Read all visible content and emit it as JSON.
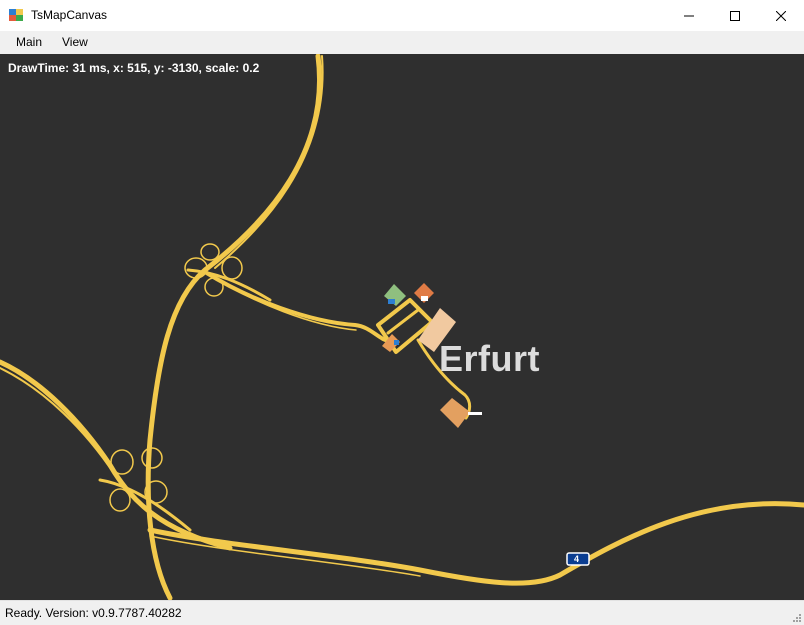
{
  "window": {
    "title": "TsMapCanvas",
    "controls": [
      "minimize-icon",
      "maximize-icon",
      "close-icon"
    ]
  },
  "menu": {
    "items": [
      {
        "label": "Main"
      },
      {
        "label": "View"
      }
    ]
  },
  "map": {
    "draw_info": "DrawTime: 31 ms, x: 515, y: -3130, scale: 0.2",
    "city_label": "Erfurt",
    "road_shield": "4",
    "colors": {
      "background": "#2f2f2f",
      "road": "#f2c94c",
      "city_text": "#dcdcdc",
      "shield": "#0a3d91"
    },
    "icons": [
      "prefab-building-icon",
      "company-icon",
      "gas-station-icon",
      "parking-icon",
      "service-icon"
    ]
  },
  "status": {
    "text": "Ready.  Version: v0.9.7787.40282"
  }
}
